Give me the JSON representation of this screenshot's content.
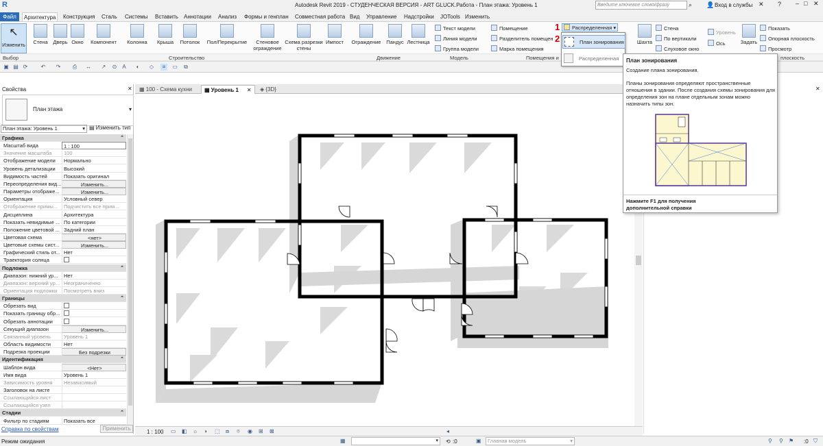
{
  "app": {
    "title": "Autodesk Revit 2019 - СТУДЕНЧЕСКАЯ ВЕРСИЯ - ART GLUCK.Работа - План этажа: Уровень 1",
    "search_placeholder": "Введите ключевое слово/фразу",
    "login": "Вход в службы",
    "logo": "R"
  },
  "menu": [
    "Файл",
    "Архитектура",
    "Конструкция",
    "Сталь",
    "Системы",
    "Вставить",
    "Аннотации",
    "Анализ",
    "Формы и генплан",
    "Совместная работа",
    "Вид",
    "Управление",
    "Надстройки",
    "JOTools",
    "Изменить"
  ],
  "ribbon": {
    "modify": "Изменить",
    "build": [
      "Стена",
      "Дверь",
      "Окно",
      "Компонент",
      "Колонна",
      "Крыша",
      "Потолок",
      "Пол/Перекрытие",
      "Стеновое ограждение",
      "Схема разрезки стены",
      "Импост"
    ],
    "circulation": [
      "Ограждение",
      "Пандус",
      "Лестница"
    ],
    "model": [
      "Текст модели",
      "Линия модели",
      "Группа модели"
    ],
    "room": [
      "Помещение",
      "Разделитель помещений",
      "Марка помещения"
    ],
    "room_truncated": "Разделитель помещен",
    "area_dropdown": "Распределенная",
    "shaft": [
      "Шахта",
      "По"
    ],
    "opening": [
      "Стена",
      "По вертикали",
      "Слуховое окно"
    ],
    "datum": [
      "Уровень",
      "Ось"
    ],
    "workplane": [
      "Задать",
      "Показать",
      "Опорная плоскость",
      "Просмотр"
    ],
    "panels": {
      "select": "Выбор",
      "build": "Строительство",
      "circulation": "Движение",
      "model": "Модель",
      "room": "Помещения и",
      "workplane": "плоскость"
    },
    "marker1": "1",
    "marker2": "2"
  },
  "dropdown": {
    "items": [
      "План зонирования",
      "Распределенная"
    ]
  },
  "tooltip": {
    "title": "План зонирования",
    "subtitle": "Создание плана зонирования.",
    "body": "Планы зонирования определяют пространственные отношения в здании. После создания схемы зонирования для определения зон на плане отдельным зонам можно назначить типы зон.",
    "help": "Нажмите F1 для получения дополнительной справки"
  },
  "props": {
    "title": "Свойства",
    "type_name": "План этажа",
    "instance": "План этажа: Уровень 1",
    "edit_type": "Изменить тип",
    "rows": [
      {
        "k": "Графика",
        "cat": true
      },
      {
        "k": "Масштаб вида",
        "v": "1 : 100",
        "input": true
      },
      {
        "k": "Значение масштаба",
        "v": "100",
        "dim": true
      },
      {
        "k": "Отображение модели",
        "v": "Нормально"
      },
      {
        "k": "Уровень детализации",
        "v": "Высокий"
      },
      {
        "k": "Видимость частей",
        "v": "Показать оригинал"
      },
      {
        "k": "Переопределения вид...",
        "v": "Изменить...",
        "btn": true
      },
      {
        "k": "Параметры отображе...",
        "v": "Изменить...",
        "btn": true
      },
      {
        "k": "Ориентация",
        "v": "Условный север"
      },
      {
        "k": "Отображение примы...",
        "v": "Подчистить все прим...",
        "dim": true
      },
      {
        "k": "Дисциплина",
        "v": "Архитектура"
      },
      {
        "k": "Показать невидимые ...",
        "v": "По категории"
      },
      {
        "k": "Положение цветовой ...",
        "v": "Задний план"
      },
      {
        "k": "Цветовая схема",
        "v": "<нет>",
        "btn": true
      },
      {
        "k": "Цветовые схемы сист...",
        "v": "Изменить...",
        "btn": true
      },
      {
        "k": "Графический стиль от...",
        "v": "Нет"
      },
      {
        "k": "Траектория солнца",
        "v": "",
        "check": true
      },
      {
        "k": "Подложка",
        "cat": true
      },
      {
        "k": "Диапазон: нижний ур...",
        "v": "Нет"
      },
      {
        "k": "Диапазон: верхний ур...",
        "v": "Неограниченно",
        "dim": true
      },
      {
        "k": "Ориентация подложки",
        "v": "Посмотреть вниз",
        "dim": true
      },
      {
        "k": "Границы",
        "cat": true
      },
      {
        "k": "Обрезать вид",
        "v": "",
        "check": true
      },
      {
        "k": "Показать границу обр...",
        "v": "",
        "check": true
      },
      {
        "k": "Обрезать аннотации",
        "v": "",
        "check": true
      },
      {
        "k": "Секущий диапазон",
        "v": "Изменить...",
        "btn": true
      },
      {
        "k": "Связанный уровень",
        "v": "Уровень 1",
        "dim": true
      },
      {
        "k": "Область видимости",
        "v": "Нет"
      },
      {
        "k": "Подрезка проекции",
        "v": "Без подрезки",
        "btn": true
      },
      {
        "k": "Идентификация",
        "cat": true
      },
      {
        "k": "Шаблон вида",
        "v": "<Нет>",
        "btn": true
      },
      {
        "k": "Имя вида",
        "v": "Уровень 1"
      },
      {
        "k": "Зависимость уровня",
        "v": "Независимый",
        "dim": true
      },
      {
        "k": "Заголовок на листе",
        "v": ""
      },
      {
        "k": "Ссылающийся лист",
        "v": "",
        "dim": true
      },
      {
        "k": "Ссылающийся узел",
        "v": "",
        "dim": true
      },
      {
        "k": "Стадии",
        "cat": true
      },
      {
        "k": "Фильтр по стадиям",
        "v": "Показать все"
      }
    ],
    "help_link": "Справка по свойствам",
    "apply": "Применить"
  },
  "tabs": [
    "100 - Схема кухни",
    "Уровень 1",
    "{3D}"
  ],
  "viewbar": {
    "scale": "1 : 100"
  },
  "status": {
    "text": "Режим ожидания",
    "model": "Главная модель",
    "zero": ":0"
  },
  "colors": {
    "accent": "#2d6db5",
    "wall": "#000000",
    "shadow": "#d9d9d9"
  }
}
